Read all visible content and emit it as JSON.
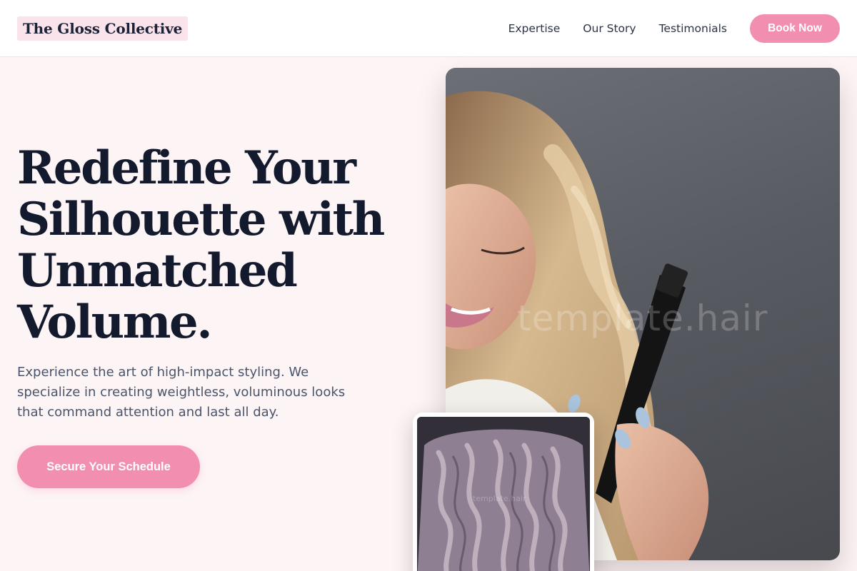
{
  "header": {
    "brand": "The Gloss Collective",
    "nav": [
      {
        "label": "Expertise"
      },
      {
        "label": "Our Story"
      },
      {
        "label": "Testimonials"
      }
    ],
    "cta_label": "Book Now"
  },
  "hero": {
    "title": "Redefine Your Silhouette with Unmatched Volume.",
    "subtitle": "Experience the art of high-impact styling. We specialize in creating weightless, voluminous looks that command attention and last all day.",
    "cta_label": "Secure Your Schedule"
  },
  "images": {
    "main_watermark": "template.hair",
    "secondary_watermark": "template.hair"
  },
  "colors": {
    "accent": "#f28fb0",
    "brand_highlight": "#fbe3ec",
    "page_background": "#fdf4f5",
    "heading": "#131a2e"
  }
}
